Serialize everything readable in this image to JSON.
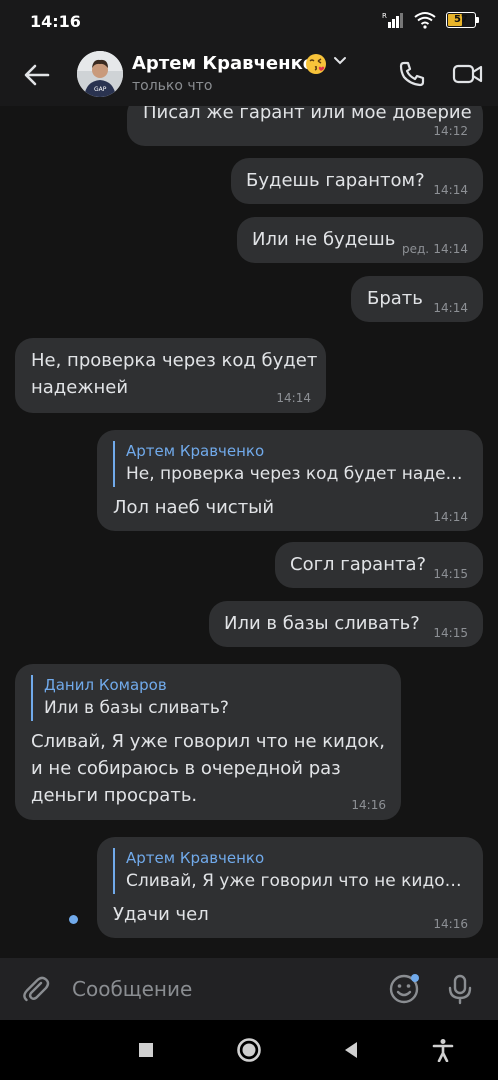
{
  "status_bar": {
    "time": "14:16",
    "battery": "57",
    "battery_level": 0.57
  },
  "header": {
    "contact_name": "Артем Кравченко",
    "contact_status": "только что",
    "emoji_name": "kissing-face-icon"
  },
  "messages": [
    {
      "text": "Писал же гарант или мое доверие",
      "time": "14:12",
      "direction": "out"
    },
    {
      "text": "Будешь гарантом?",
      "time": "14:14",
      "direction": "out"
    },
    {
      "text": "Или не будешь",
      "edited": "ред.",
      "time": "14:14",
      "direction": "out"
    },
    {
      "text": "Брать",
      "time": "14:14",
      "direction": "out"
    },
    {
      "lines": [
        "Не, проверка через код будет",
        "надежней"
      ],
      "time": "14:14",
      "direction": "in"
    },
    {
      "reply_name": "Артем Кравченко",
      "reply_text": "Не, проверка через код будет надеж...",
      "text": "Лол наеб чистый",
      "time": "14:14",
      "direction": "out"
    },
    {
      "text": "Согл гаранта?",
      "time": "14:15",
      "direction": "out"
    },
    {
      "text": "Или в базы сливать?",
      "time": "14:15",
      "direction": "out"
    },
    {
      "reply_name": "Данил Комаров",
      "reply_text": "Или в базы сливать?",
      "lines": [
        "Сливай, Я уже говорил что не кидок,",
        "и не собираюсь в очередной раз",
        "деньги просрать."
      ],
      "time": "14:16",
      "direction": "in"
    },
    {
      "reply_name": "Артем Кравченко",
      "reply_text": "Сливай, Я уже говорил что не кидок,...",
      "text": "Удачи чел",
      "time": "14:16",
      "direction": "out",
      "unread": true
    }
  ],
  "composer": {
    "placeholder": "Сообщение"
  },
  "colors": {
    "accent": "#71aaeb",
    "bubble": "#2f3032",
    "background": "#141414",
    "bar": "#19191a"
  }
}
